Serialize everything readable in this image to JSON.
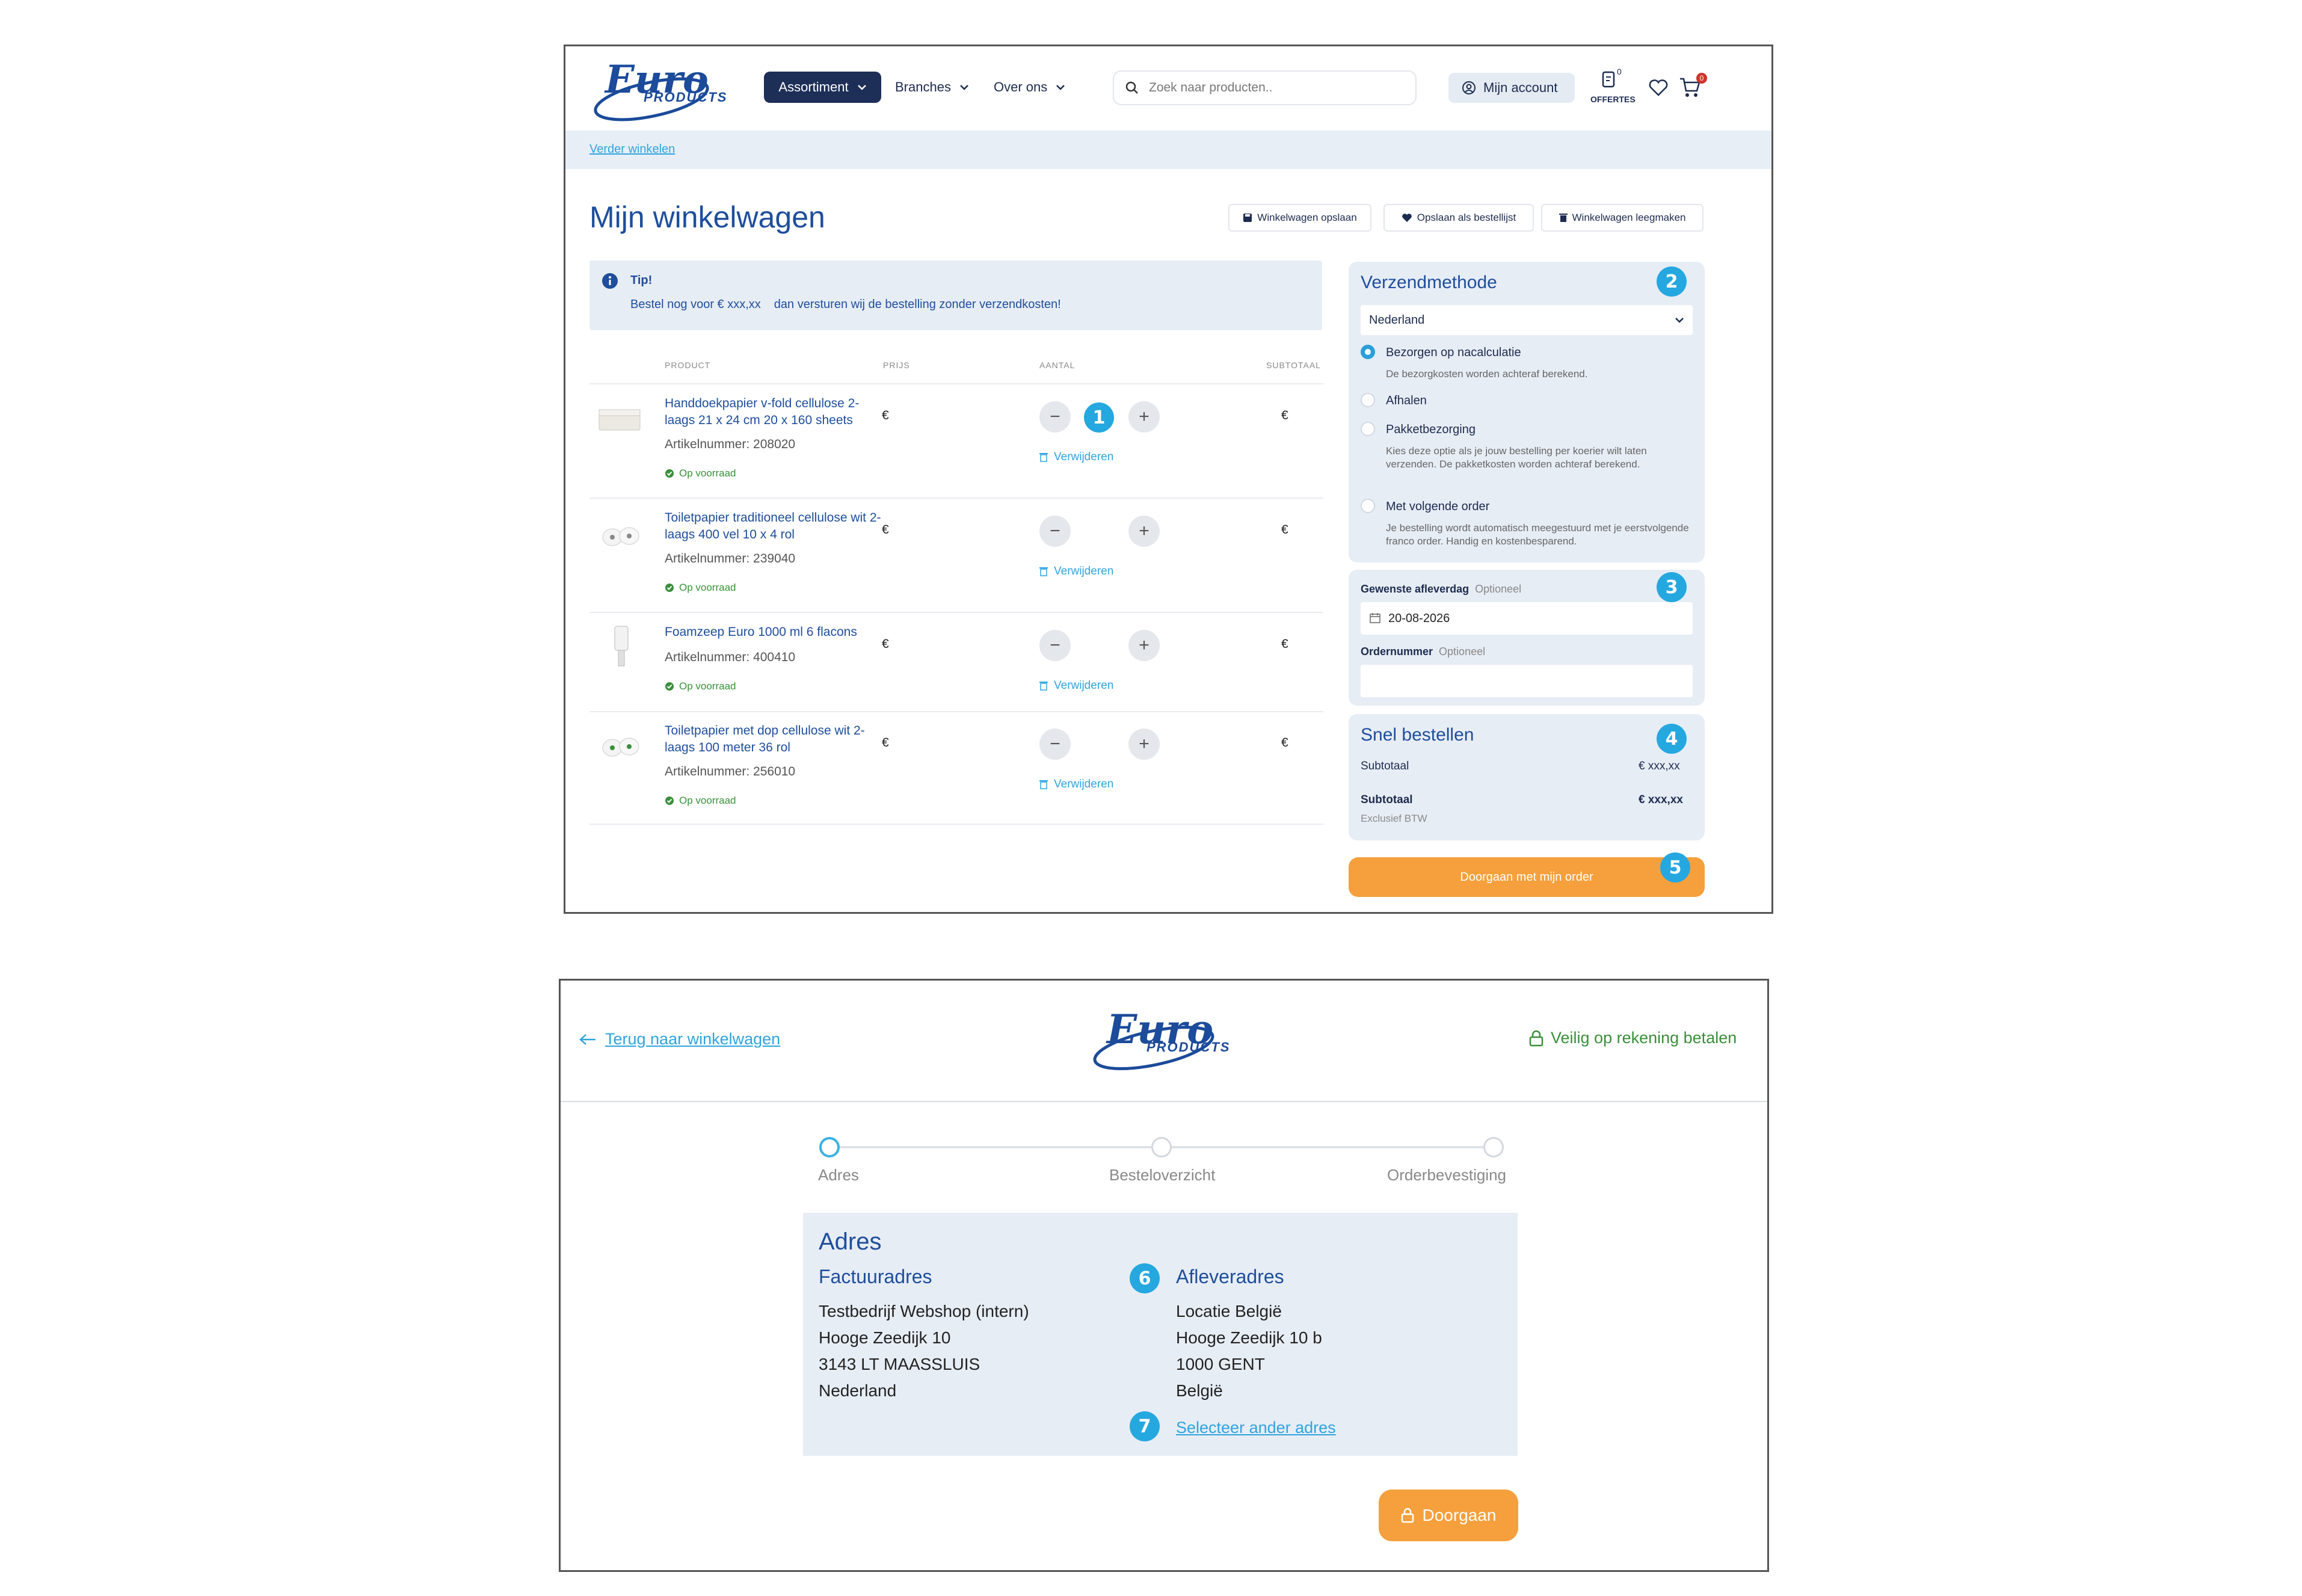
{
  "top": {
    "logo": {
      "word": "Euro",
      "sub": "PRODUCTS"
    },
    "nav": {
      "assortiment": "Assortiment",
      "branches": "Branches",
      "over_ons": "Over ons"
    },
    "search": {
      "placeholder": "Zoek naar producten.."
    },
    "account": "Mijn account",
    "offertes": {
      "label": "OFFERTES",
      "count": "0"
    },
    "cart_count": "0",
    "breadcrumb": "Verder winkelen",
    "page_title": "Mijn winkelwagen",
    "actions": {
      "save": "Winkelwagen opslaan",
      "save_list": "Opslaan als bestellijst",
      "empty": "Winkelwagen leegmaken"
    },
    "tip": {
      "title": "Tip!",
      "text_before": "Bestel nog voor € xxx,xx",
      "text_after": "dan versturen wij de bestelling zonder verzendkosten!"
    },
    "table_headers": {
      "product": "PRODUCT",
      "price": "PRIJS",
      "qty": "AANTAL",
      "subtotal": "SUBTOTAAL"
    },
    "items": [
      {
        "name": "Handdoekpapier v-fold cellulose 2-laags 21 x 24 cm 20 x 160 sheets",
        "article": "Artikelnummer: 208020",
        "stock": "Op voorraad",
        "price": "€",
        "qty": "1",
        "subtotal": "€",
        "remove": "Verwijderen"
      },
      {
        "name": "Toiletpapier traditioneel cellulose wit 2-laags 400 vel 10 x 4 rol",
        "article": "Artikelnummer: 239040",
        "stock": "Op voorraad",
        "price": "€",
        "qty": "",
        "subtotal": "€",
        "remove": "Verwijderen"
      },
      {
        "name": "Foamzeep Euro 1000 ml 6 flacons",
        "article": "Artikelnummer: 400410",
        "stock": "Op voorraad",
        "price": "€",
        "qty": "",
        "subtotal": "€",
        "remove": "Verwijderen"
      },
      {
        "name": "Toiletpapier met dop cellulose wit 2-laags 100 meter 36 rol",
        "article": "Artikelnummer: 256010",
        "stock": "Op voorraad",
        "price": "€",
        "qty": "",
        "subtotal": "€",
        "remove": "Verwijderen"
      }
    ],
    "shipping": {
      "title": "Verzendmethode",
      "country": "Nederland",
      "options": [
        {
          "title": "Bezorgen op nacalculatie",
          "desc": "De bezorgkosten worden achteraf berekend.",
          "selected": true
        },
        {
          "title": "Afhalen",
          "desc": "",
          "selected": false
        },
        {
          "title": "Pakketbezorging",
          "desc": "Kies deze optie als je jouw bestelling per koerier wilt laten verzenden. De pakketkosten worden achteraf berekend.",
          "selected": false
        },
        {
          "title": "Met volgende order",
          "desc": "Je bestelling wordt automatisch meegestuurd met je eerstvolgende franco order. Handig en kostenbesparend.",
          "selected": false
        }
      ]
    },
    "delivery": {
      "date_label": "Gewenste afleverdag",
      "optional": "Optioneel",
      "date_value": "20-08-2026",
      "order_label": "Ordernummer",
      "order_value": ""
    },
    "quick": {
      "title": "Snel bestellen",
      "subtotal_label": "Subtotaal",
      "subtotal_value": "€ xxx,xx",
      "subtotal2_label": "Subtotaal",
      "subtotal2_value": "€ xxx,xx",
      "excl": "Exclusief BTW"
    },
    "continue": "Doorgaan met mijn order",
    "badges": {
      "b1": "1",
      "b2": "2",
      "b3": "3",
      "b4": "4",
      "b5": "5"
    }
  },
  "bottom": {
    "back": "Terug naar winkelwagen",
    "secure": "Veilig op rekening betalen",
    "steps": [
      "Adres",
      "Besteloverzicht",
      "Orderbevestiging"
    ],
    "title": "Adres",
    "billing": {
      "title": "Factuuradres",
      "lines": [
        "Testbedrijf Webshop (intern)",
        "Hooge Zeedijk 10",
        "3143 LT MAASSLUIS",
        "Nederland"
      ]
    },
    "delivery": {
      "title": "Afleveradres",
      "lines": [
        "Locatie België",
        "Hooge Zeedijk 10 b",
        "1000 GENT",
        "België"
      ]
    },
    "select_other": "Selecteer ander adres",
    "continue": "Doorgaan",
    "badges": {
      "b6": "6",
      "b7": "7"
    }
  },
  "colors": {
    "navy": "#1d2e57",
    "brand_blue": "#1e4e9c",
    "accent_cyan": "#25a8e0",
    "panel_bg": "#e7edf5",
    "orange": "#f5a03c",
    "green": "#3a8f3a"
  },
  "icons": [
    "chevron-down-icon",
    "search-icon",
    "user-icon",
    "document-icon",
    "heart-icon",
    "cart-icon",
    "save-icon",
    "trash-icon",
    "info-icon",
    "calendar-icon",
    "check-circle-icon",
    "arrow-left-icon",
    "lock-icon"
  ]
}
